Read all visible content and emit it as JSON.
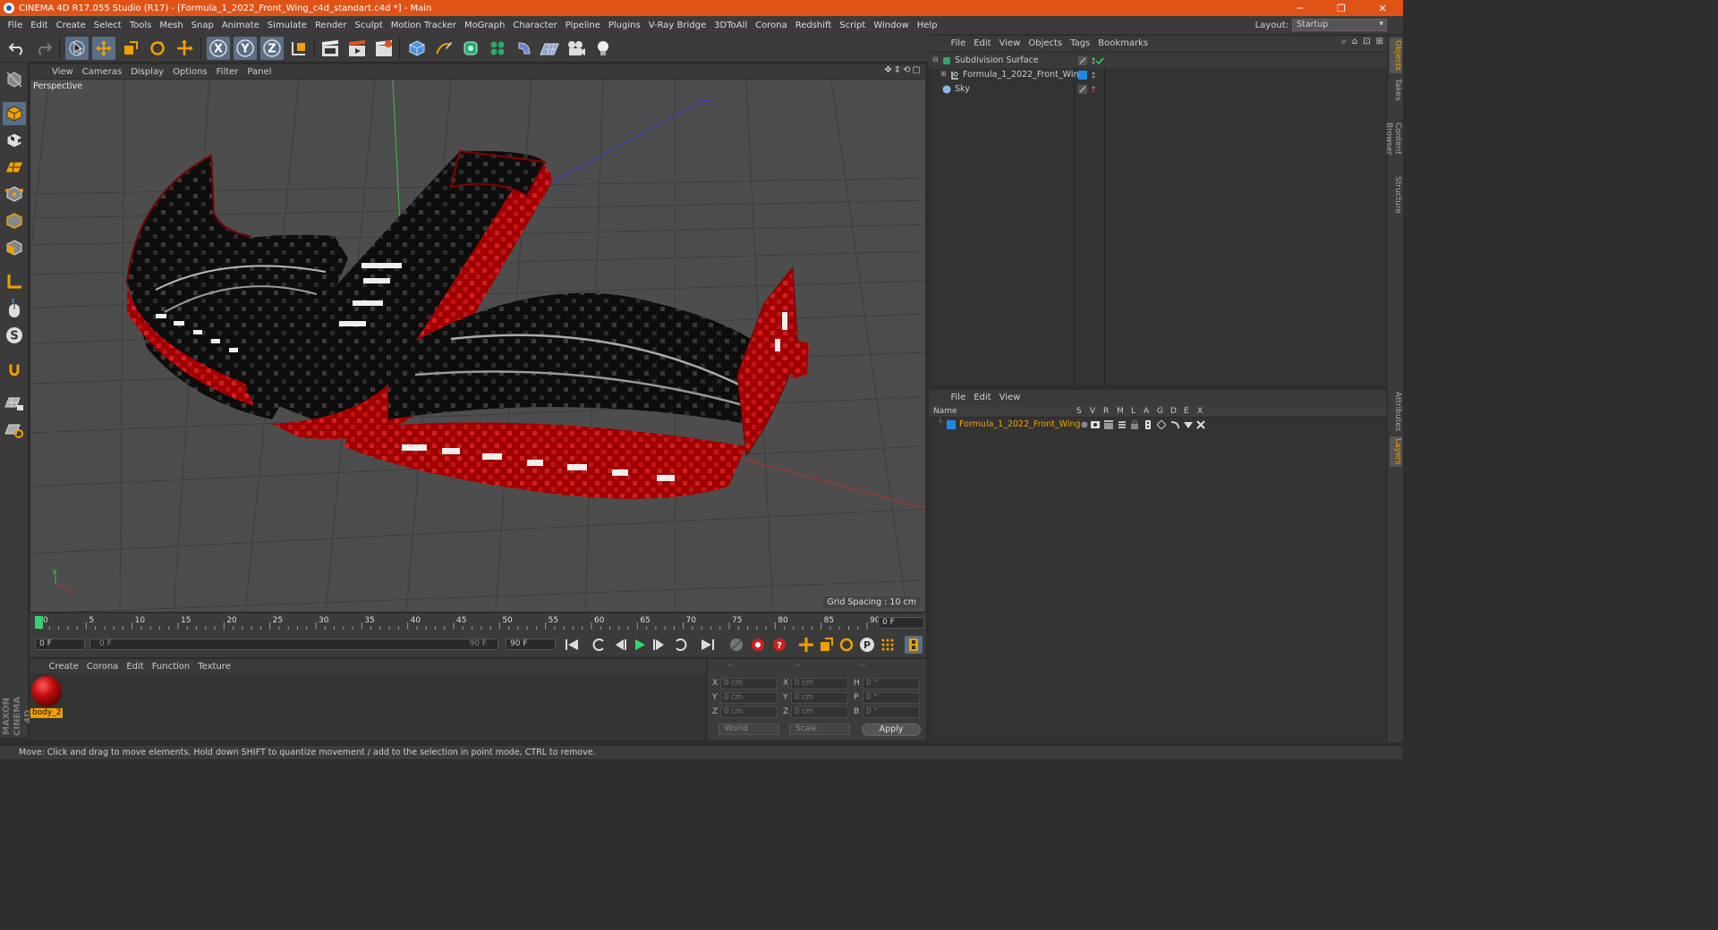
{
  "window": {
    "title": "CINEMA 4D R17.055 Studio (R17) - [Formula_1_2022_Front_Wing_c4d_standart.c4d *] - Main",
    "minimize": "─",
    "maximize": "❐",
    "close": "✕"
  },
  "menu": [
    "File",
    "Edit",
    "Create",
    "Select",
    "Tools",
    "Mesh",
    "Snap",
    "Animate",
    "Simulate",
    "Render",
    "Sculpt",
    "Motion Tracker",
    "MoGraph",
    "Character",
    "Pipeline",
    "Plugins",
    "V-Ray Bridge",
    "3DToAll",
    "Corona",
    "Redshift",
    "Script",
    "Window",
    "Help"
  ],
  "layout": {
    "label": "Layout:",
    "value": "Startup"
  },
  "viewport": {
    "menu": [
      "View",
      "Cameras",
      "Display",
      "Options",
      "Filter",
      "Panel"
    ],
    "label": "Perspective",
    "grid_spacing": "Grid Spacing : 10 cm",
    "nav_icons": [
      "✥",
      "⇕",
      "⟲",
      "▢"
    ]
  },
  "timeline": {
    "ticks": [
      "0",
      "5",
      "10",
      "15",
      "20",
      "25",
      "30",
      "35",
      "40",
      "45",
      "50",
      "55",
      "60",
      "65",
      "70",
      "75",
      "80",
      "85",
      "90"
    ],
    "current_frame": "0 F",
    "start_field": "0 F",
    "range_start": "0 F",
    "range_end": "90 F",
    "end_field": "90 F"
  },
  "material_manager": {
    "menu": [
      "Create",
      "Corona",
      "Edit",
      "Function",
      "Texture"
    ],
    "material_name": "body_2"
  },
  "coordinates": {
    "headers": [
      "--",
      "--",
      "--"
    ],
    "rows": [
      {
        "a": "X",
        "av": "0 cm",
        "b": "X",
        "bv": "0 cm",
        "c": "H",
        "cv": "0 °"
      },
      {
        "a": "Y",
        "av": "0 cm",
        "b": "Y",
        "bv": "0 cm",
        "c": "P",
        "cv": "0 °"
      },
      {
        "a": "Z",
        "av": "0 cm",
        "b": "Z",
        "bv": "0 cm",
        "c": "B",
        "cv": "0 °"
      }
    ],
    "space": "World",
    "mode": "Scale",
    "apply": "Apply"
  },
  "object_manager": {
    "menu": [
      "File",
      "Edit",
      "View",
      "Objects",
      "Tags",
      "Bookmarks"
    ],
    "objects": [
      {
        "name": "Subdivision Surface"
      },
      {
        "name": "Formula_1_2022_Front_Wing"
      },
      {
        "name": "Sky"
      }
    ]
  },
  "layer_manager": {
    "menu": [
      "File",
      "Edit",
      "View"
    ],
    "name_header": "Name",
    "columns": [
      "S",
      "V",
      "R",
      "M",
      "L",
      "A",
      "G",
      "D",
      "E",
      "X"
    ],
    "layers": [
      {
        "name": "Formula_1_2022_Front_Wing"
      }
    ]
  },
  "right_tabs": [
    "Objects",
    "Takes",
    "Content Browser",
    "Structure",
    "Attributes",
    "Layers"
  ],
  "status": "Move: Click and drag to move elements. Hold down SHIFT to quantize movement / add to the selection in point mode, CTRL to remove.",
  "branding": "MAXON CINEMA 4D",
  "colors": {
    "accent": "#e05316",
    "selection": "#f0a000",
    "active_tool": "#5a6f86"
  }
}
